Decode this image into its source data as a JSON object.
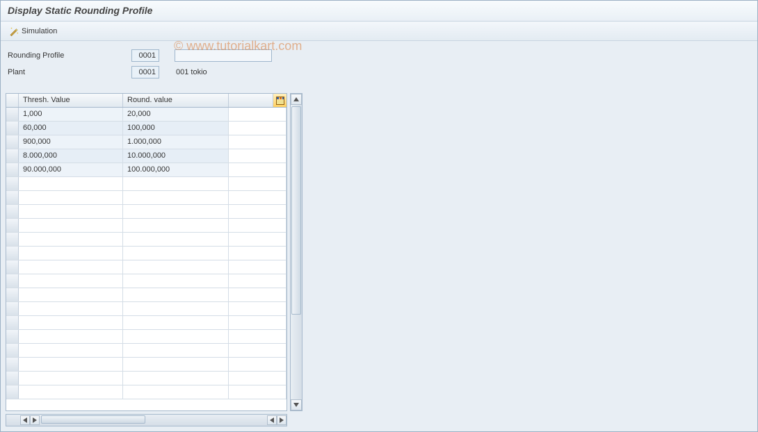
{
  "title": "Display Static Rounding Profile",
  "toolbar": {
    "simulation_label": "Simulation"
  },
  "form": {
    "rounding_profile_label": "Rounding Profile",
    "rounding_profile_value": "0001",
    "plant_label": "Plant",
    "plant_value": "0001",
    "plant_desc": "001 tokio"
  },
  "grid": {
    "headers": {
      "sel": "",
      "thresh": "Thresh. Value",
      "round": "Round. value"
    },
    "rows": [
      {
        "thresh": "1,000",
        "round": "20,000"
      },
      {
        "thresh": "60,000",
        "round": "100,000"
      },
      {
        "thresh": "900,000",
        "round": "1.000,000"
      },
      {
        "thresh": "8.000,000",
        "round": "10.000,000"
      },
      {
        "thresh": "90.000,000",
        "round": "100.000,000"
      }
    ],
    "empty_rows": 16
  },
  "watermark": "© www.tutorialkart.com"
}
